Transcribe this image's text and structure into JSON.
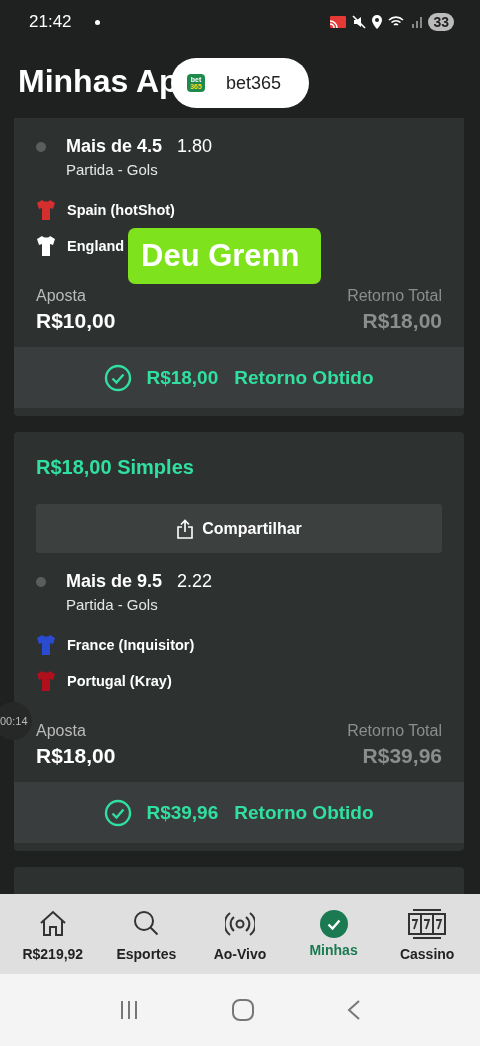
{
  "status_bar": {
    "time": "21:42",
    "battery": "33"
  },
  "header": {
    "title": "Minhas Ap"
  },
  "toast": {
    "logo_lines": [
      "bet",
      "365"
    ],
    "label": "bet365"
  },
  "sticker": {
    "text": "Deu Grenn"
  },
  "video_timer": "00:14",
  "bets": [
    {
      "selection": {
        "market": "Mais de 4.5",
        "odds": "1.80",
        "type": "Partida - Gols"
      },
      "teams": [
        {
          "name": "Spain (hotShot)",
          "color": "#d32f2f"
        },
        {
          "name": "England",
          "color": "#ffffff"
        }
      ],
      "stake_label": "Aposta",
      "stake": "R$10,00",
      "return_label": "Retorno Total",
      "return": "R$18,00",
      "result_amount": "R$18,00",
      "result_label": "Retorno Obtido"
    },
    {
      "heading": "R$18,00 Simples",
      "share": "Compartilhar",
      "selection": {
        "market": "Mais de 9.5",
        "odds": "2.22",
        "type": "Partida - Gols"
      },
      "teams": [
        {
          "name": "France (Inquisitor)",
          "color": "#2a4bd0"
        },
        {
          "name": "Portugal (Kray)",
          "color": "#b0101c"
        }
      ],
      "stake_label": "Aposta",
      "stake": "R$18,00",
      "return_label": "Retorno Total",
      "return": "R$39,96",
      "result_amount": "R$39,96",
      "result_label": "Retorno Obtido"
    }
  ],
  "nav": [
    {
      "kind": "home",
      "label": "R$219,92",
      "selected": false
    },
    {
      "kind": "search",
      "label": "Esportes",
      "selected": false
    },
    {
      "kind": "live",
      "label": "Ao-Vivo",
      "selected": false
    },
    {
      "kind": "bets",
      "label": "Minhas",
      "selected": true
    },
    {
      "kind": "casino",
      "label": "Cassino",
      "selected": false
    }
  ]
}
